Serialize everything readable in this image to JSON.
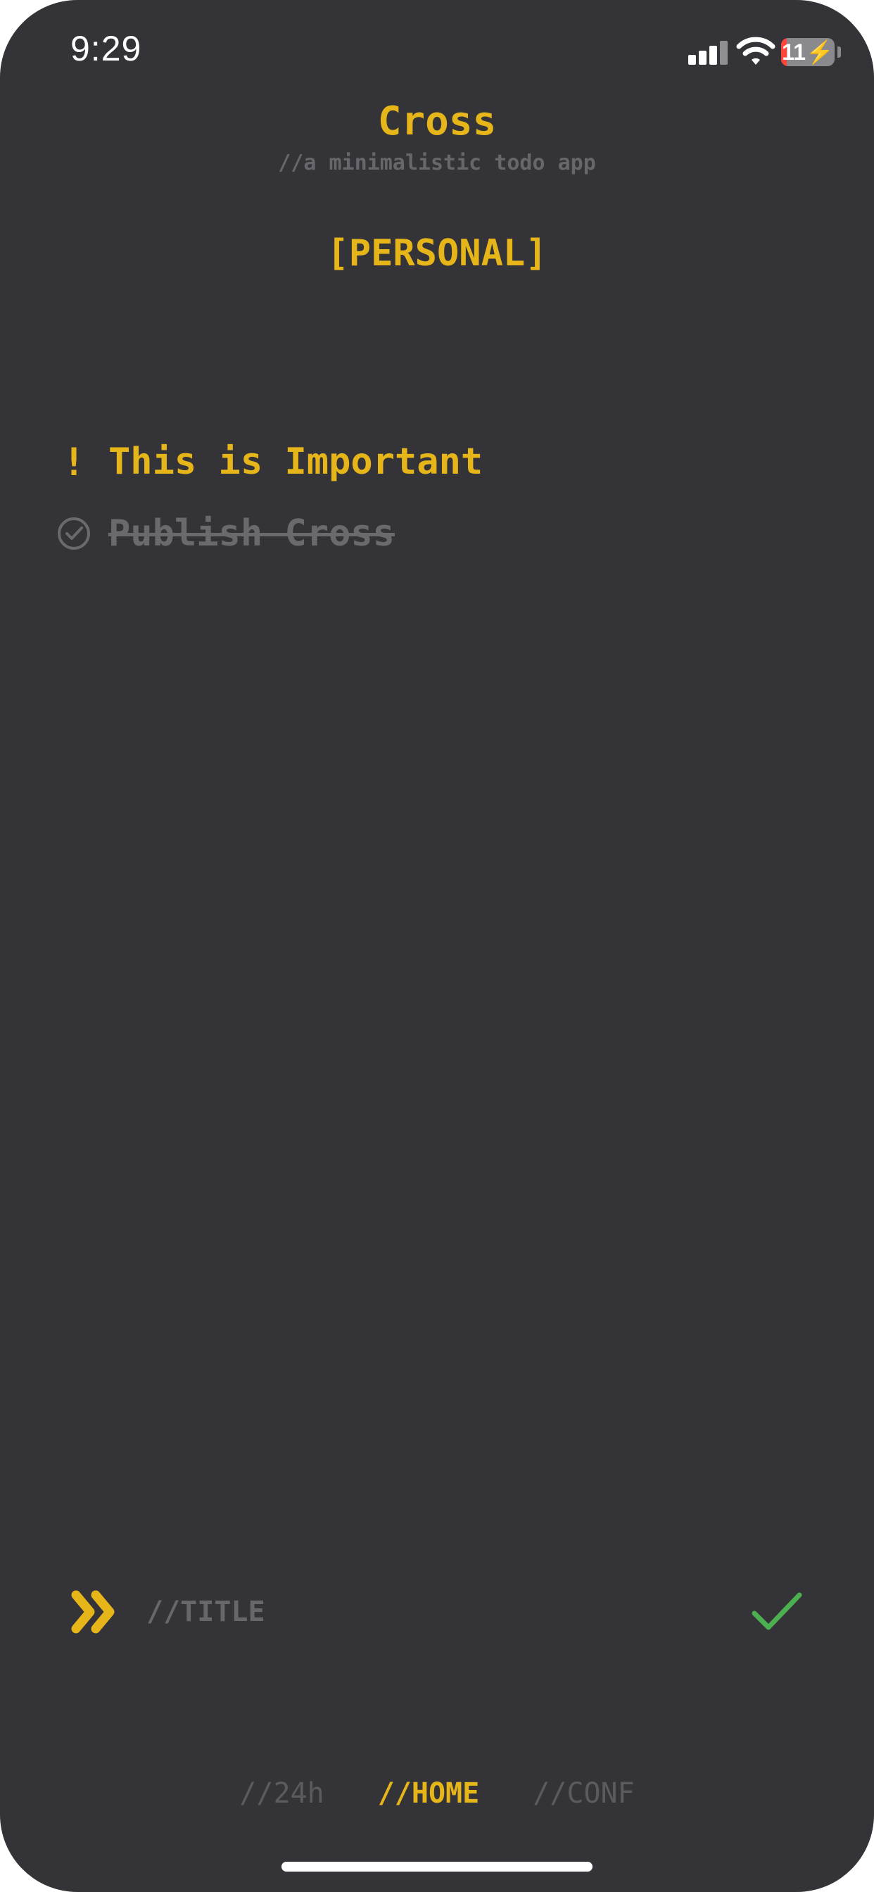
{
  "status_bar": {
    "time": "9:29",
    "battery_level": "11",
    "signal_icon": "cellular-signal-icon",
    "wifi_icon": "wifi-icon",
    "battery_icon": "battery-charging-icon"
  },
  "header": {
    "title": "Cross",
    "subtitle": "//a minimalistic todo app"
  },
  "list": {
    "name": "[PERSONAL]"
  },
  "tasks": [
    {
      "marker": "!",
      "text": "This is Important",
      "state": "important",
      "icon": "exclamation-icon"
    },
    {
      "text": "Publish Cross",
      "state": "done",
      "icon": "check-circle-icon"
    }
  ],
  "input": {
    "placeholder": "//TITLE",
    "value": "",
    "prefix_icon": "double-chevron-right-icon",
    "confirm_icon": "checkmark-icon"
  },
  "nav": {
    "items": [
      {
        "label": "//24h",
        "active": false
      },
      {
        "label": "//HOME",
        "active": true
      },
      {
        "label": "//CONF",
        "active": false
      }
    ]
  },
  "colors": {
    "background": "#343438",
    "accent": "#e5b51a",
    "muted": "#66666b",
    "confirm": "#4caf50",
    "battery_low": "#ff453a"
  }
}
